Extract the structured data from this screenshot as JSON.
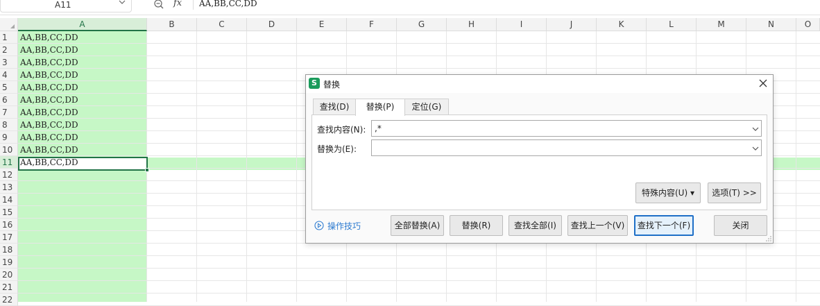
{
  "formula_bar": {
    "cell_ref": "A11",
    "formula": "AA,BB,CC,DD",
    "fx_label": "fx"
  },
  "sheet": {
    "columns": [
      "A",
      "B",
      "C",
      "D",
      "E",
      "F",
      "G",
      "H",
      "I",
      "J",
      "K",
      "L",
      "M",
      "N",
      "O"
    ],
    "rows": [
      "1",
      "2",
      "3",
      "4",
      "5",
      "6",
      "7",
      "8",
      "9",
      "10",
      "11",
      "12",
      "13",
      "14",
      "15",
      "16",
      "17",
      "18",
      "19",
      "20",
      "21",
      "22"
    ],
    "column_a_values": [
      "AA,BB,CC,DD",
      "AA,BB,CC,DD",
      "AA,BB,CC,DD",
      "AA,BB,CC,DD",
      "AA,BB,CC,DD",
      "AA,BB,CC,DD",
      "AA,BB,CC,DD",
      "AA,BB,CC,DD",
      "AA,BB,CC,DD",
      "AA,BB,CC,DD",
      "AA,BB,CC,DD"
    ],
    "active_cell": "A11",
    "selection_color": "#c6f7c6",
    "accent_color": "#217346"
  },
  "dialog": {
    "title": "替换",
    "app_icon_letter": "S",
    "tabs": [
      {
        "label": "查找(D)",
        "active": false
      },
      {
        "label": "替换(P)",
        "active": true
      },
      {
        "label": "定位(G)",
        "active": false
      }
    ],
    "find_label": "查找内容(N):",
    "find_value": ",*",
    "replace_label": "替换为(E):",
    "replace_value": "",
    "special_button": "特殊内容(U) ▾",
    "options_button": "选项(T) >>",
    "hint_link": "操作技巧",
    "buttons": {
      "replace_all": "全部替换(A)",
      "replace": "替换(R)",
      "find_all": "查找全部(I)",
      "find_prev": "查找上一个(V)",
      "find_next": "查找下一个(F)",
      "close": "关闭"
    }
  }
}
